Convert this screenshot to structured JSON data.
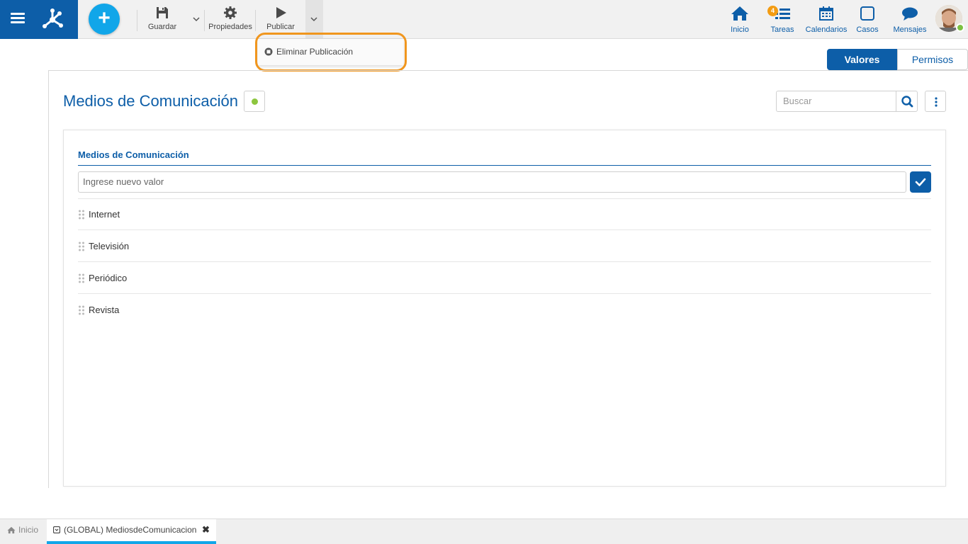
{
  "toolbar": {
    "save_label": "Guardar",
    "properties_label": "Propiedades",
    "publish_label": "Publicar"
  },
  "publish_menu": {
    "items": [
      {
        "label": "Eliminar Publicación"
      }
    ]
  },
  "nav": {
    "home_label": "Inicio",
    "tasks_label": "Tareas",
    "tasks_badge": "4",
    "calendars_label": "Calendarios",
    "cases_label": "Casos",
    "messages_label": "Mensajes"
  },
  "view_tabs": {
    "values_label": "Valores",
    "permissions_label": "Permisos"
  },
  "page": {
    "title": "Medios de Comunicación",
    "status_color": "#8dc63f",
    "search_placeholder": "Buscar"
  },
  "list": {
    "section_title": "Medios de Comunicación",
    "new_value_placeholder": "Ingrese nuevo valor",
    "items": [
      {
        "label": "Internet"
      },
      {
        "label": "Televisión"
      },
      {
        "label": "Periódico"
      },
      {
        "label": "Revista"
      }
    ]
  },
  "bottom_tabs": {
    "home_label": "Inicio",
    "active_label": "(GLOBAL) MediosdeComunicacion"
  },
  "colors": {
    "brand": "#0d5ea8",
    "accent": "#11a6e9",
    "highlight": "#f0961e"
  }
}
